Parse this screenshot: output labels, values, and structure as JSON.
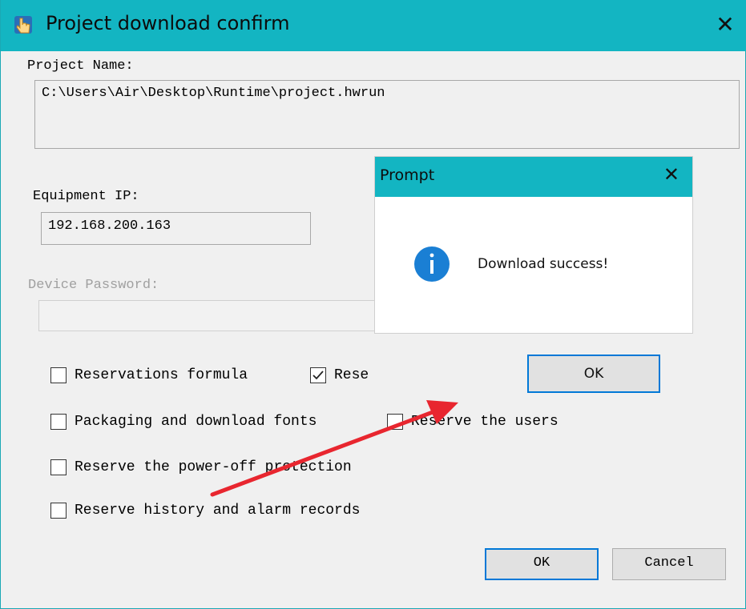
{
  "window": {
    "title": "Project download confirm",
    "close_glyph": "✕"
  },
  "project": {
    "name_label": "Project Name:",
    "name_value": "C:\\Users\\Air\\Desktop\\Runtime\\project.hwrun"
  },
  "equipment": {
    "ip_label": "Equipment IP:",
    "ip_value": "192.168.200.163"
  },
  "device": {
    "password_label": "Device Password:",
    "password_value": ""
  },
  "options": [
    {
      "label": "Reservations formula",
      "checked": false
    },
    {
      "label": "Rese",
      "checked": true
    },
    {
      "label": "Packaging and download fonts",
      "checked": false
    },
    {
      "label": "Reserve the users",
      "checked": false
    },
    {
      "label": "Reserve the power-off protection",
      "checked": false
    },
    {
      "label": "Reserve history and alarm records",
      "checked": false
    }
  ],
  "footer": {
    "ok_label": "OK",
    "cancel_label": "Cancel"
  },
  "prompt": {
    "title": "Prompt",
    "close_glyph": "✕",
    "message": "Download success!",
    "ok_label": "OK"
  },
  "colors": {
    "titlebar": "#13b5c2",
    "accent_border": "#0078d7",
    "info_icon": "#1a7fd4",
    "annotation_arrow": "#e8262f"
  }
}
